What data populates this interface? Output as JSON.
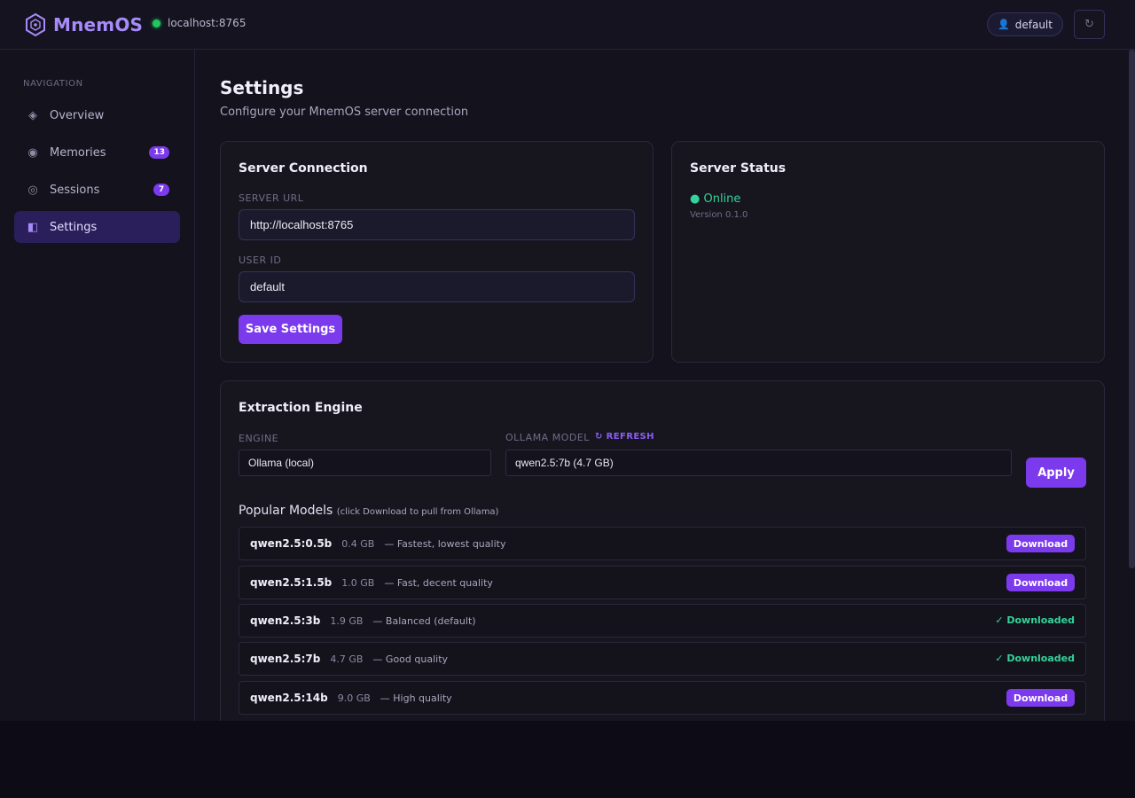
{
  "header": {
    "app_name": "MnemOS",
    "connection": "localhost:8765",
    "user": "default",
    "refresh_icon": "↻",
    "colors": {
      "accent": "#a78bfa",
      "online": "#22c55e"
    }
  },
  "sidebar": {
    "heading": "NAVIGATION",
    "items": [
      {
        "label": "Overview",
        "icon": "◈",
        "badge": ""
      },
      {
        "label": "Memories",
        "icon": "◉",
        "badge": "13"
      },
      {
        "label": "Sessions",
        "icon": "◎",
        "badge": "7"
      },
      {
        "label": "Settings",
        "icon": "◧",
        "badge": "",
        "active": true
      }
    ]
  },
  "page": {
    "title": "Settings",
    "subtitle": "Configure your MnemOS server connection"
  },
  "server_connection": {
    "title": "Server Connection",
    "url_label": "SERVER URL",
    "url_value": "http://localhost:8765",
    "user_label": "USER ID",
    "user_value": "default",
    "save_label": "Save Settings"
  },
  "server_status": {
    "title": "Server Status",
    "status": "● Online",
    "version": "Version 0.1.0"
  },
  "extraction": {
    "title": "Extraction Engine",
    "engine_label": "ENGINE",
    "engine_value": "Ollama (local)",
    "model_label": "OLLAMA MODEL",
    "refresh_label": "↻ REFRESH",
    "model_value": "qwen2.5:7b (4.7 GB)",
    "apply_label": "Apply",
    "popular_title": "Popular Models",
    "popular_hint": "(click Download to pull from Ollama)",
    "models": [
      {
        "name": "qwen2.5:0.5b",
        "size": "0.4 GB",
        "desc": "— Fastest, lowest quality",
        "action": "Download",
        "downloaded": false
      },
      {
        "name": "qwen2.5:1.5b",
        "size": "1.0 GB",
        "desc": "— Fast, decent quality",
        "action": "Download",
        "downloaded": false
      },
      {
        "name": "qwen2.5:3b",
        "size": "1.9 GB",
        "desc": "— Balanced (default)",
        "action": "✓ Downloaded",
        "downloaded": true
      },
      {
        "name": "qwen2.5:7b",
        "size": "4.7 GB",
        "desc": "— Good quality",
        "action": "✓ Downloaded",
        "downloaded": true
      },
      {
        "name": "qwen2.5:14b",
        "size": "9.0 GB",
        "desc": "— High quality",
        "action": "Download",
        "downloaded": false
      }
    ]
  }
}
